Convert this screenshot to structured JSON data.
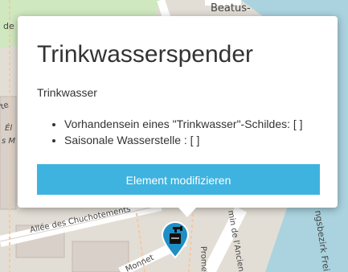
{
  "map": {
    "street_labels": [
      "Beatus-",
      "Allée des Chuchotements",
      "min de l'Ancien",
      "ngsbezirk Frei",
      "Monnet",
      "Prome",
      "de",
      "te",
      "Él",
      "s M"
    ]
  },
  "popup": {
    "title": "Trinkwasserspender",
    "description": "Trinkwasser",
    "attributes": [
      "Vorhandensein eines \"Trinkwasser\"-Schildes: [ ]",
      "Saisonale Wasserstelle : [ ]"
    ],
    "button_label": "Element modifizieren"
  },
  "colors": {
    "button": "#3fb3df",
    "marker": "#1f8ec4"
  },
  "marker": {
    "icon": "water-tap-icon"
  }
}
